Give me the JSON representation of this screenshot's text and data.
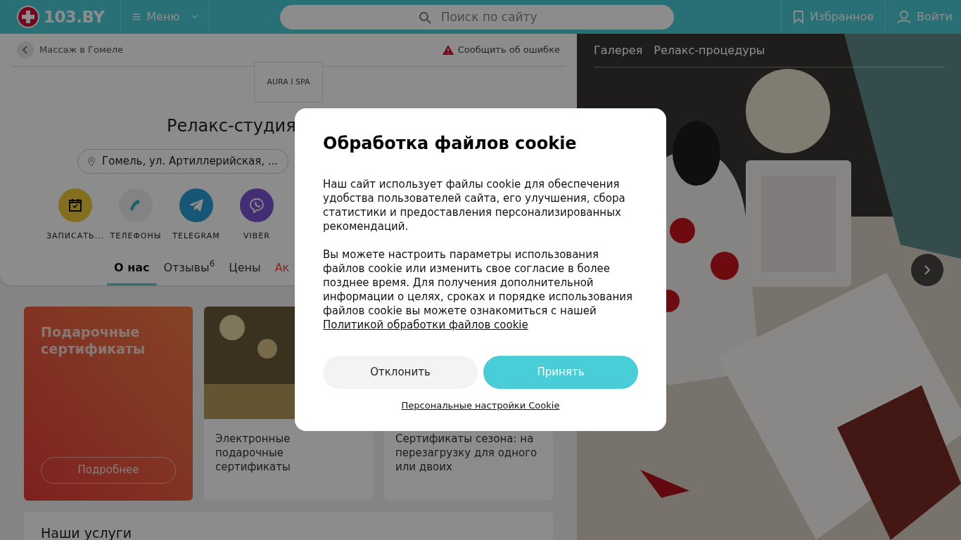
{
  "header": {
    "logo": "103.BY",
    "menu": "Меню",
    "search": {
      "placeholder": "Поиск по сайту"
    },
    "favorites": "Избранное",
    "login": "Войти"
  },
  "breadcrumb": {
    "back": "Массаж в Гомеле",
    "report": "Сообщить об ошибке"
  },
  "company": {
    "logo_text": "AURA I SPA",
    "title": "Релакс-студия",
    "address": "Гомель, ул. Артиллерийская, ..."
  },
  "actions": [
    {
      "kind": "book",
      "label": "ЗАПИСАТЬ..."
    },
    {
      "kind": "phone",
      "label": "ТЕЛЕФОНЫ"
    },
    {
      "kind": "telegram",
      "label": "TELEGRAM"
    },
    {
      "kind": "viber",
      "label": "VIBER"
    }
  ],
  "tabs": [
    {
      "label": "О нас",
      "selected": true
    },
    {
      "label": "Отзывы$^{6}$",
      "selected": false
    },
    {
      "label": "Цены",
      "selected": false
    },
    {
      "label": "Ак",
      "selected": false,
      "kind": "promo"
    }
  ],
  "promo_card": {
    "title": "Подарочные сертификаты",
    "button": "Подробнее"
  },
  "cards": [
    {
      "kind": "picture",
      "text": "Электронные подарочные сертификаты"
    },
    {
      "text": "Сертификаты сезона: на перезагрузку для одного или двоих"
    }
  ],
  "services": {
    "title": "Наши услуги"
  },
  "gallery": {
    "tabs": [
      {
        "label": "Галерея"
      },
      {
        "label": "Релакс-процедуры"
      }
    ],
    "kind": "picture"
  },
  "cookie_dialog": {
    "title": "Обработка файлов cookie",
    "paragraphs": [
      "Наш сайт использует файлы cookie для обеспечения удобства пользователей сайта, его улучшения, сбора статистики и предоставления персонализированных рекомендаций.",
      "Вы можете настроить параметры использования файлов cookie или изменить свое согласие в более позднее время. Для получения дополнительной информации о целях, сроках и порядке использования файлов cookie вы можете ознакомиться с нашей"
    ],
    "policy_link": "Политикой обработки файлов cookie",
    "decline": "Отклонить",
    "accept": "Принять",
    "settings_link": "Персональные настройки Cookie"
  }
}
